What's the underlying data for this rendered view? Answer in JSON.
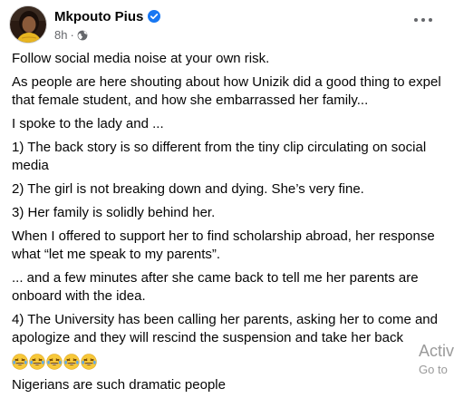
{
  "header": {
    "author_name": "Mkpouto Pius",
    "time": "8h",
    "separator": "·",
    "avatar_icon": "avatar-photo",
    "verified_icon": "verified-badge-icon",
    "audience_icon": "globe-icon",
    "more_icon": "more-options-icon"
  },
  "post": {
    "paragraphs": [
      "Follow social media noise at your own risk.",
      "As people are here shouting about how Unizik did a good thing to expel that female student, and how she embarrassed her family...",
      "I spoke to the lady and ...",
      "1) The back story is so different from the tiny clip circulating on social media",
      "2) The girl is not breaking down and dying. She’s very fine.",
      "3) Her family is solidly behind her.",
      "When I offered to support her to find scholarship abroad, her response what “let me speak to my parents”.",
      "... and a few minutes after she came back to tell me her parents are onboard with the idea.",
      "4) The University has been calling her parents, asking her to come and apologize and they will rescind the suspension and take her back"
    ],
    "emoji_icon": "rolling-on-floor-laughing-emoji",
    "closing": "Nigerians are such dramatic people"
  },
  "watermark": {
    "line1": "Activ",
    "line2": "Go to"
  },
  "colors": {
    "text": "#050505",
    "secondary": "#65676b",
    "verified": "#1877f2",
    "emoji_face": "#f7c83a"
  }
}
